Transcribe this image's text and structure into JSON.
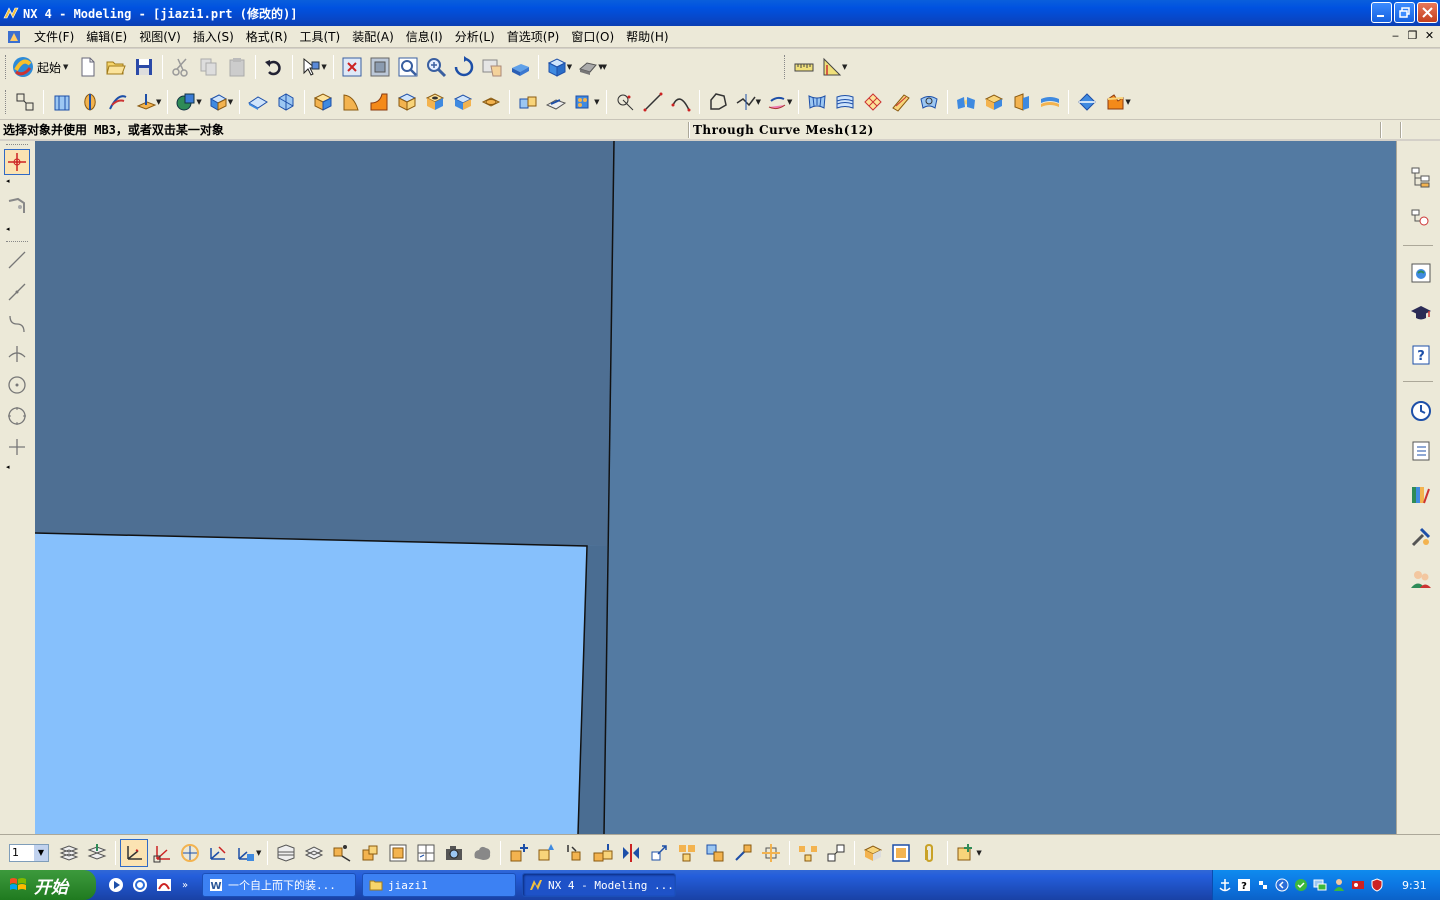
{
  "window": {
    "title": "NX 4 - Modeling - [jiazi1.prt (修改的)]"
  },
  "menubar": {
    "items": [
      "文件(F)",
      "编辑(E)",
      "视图(V)",
      "插入(S)",
      "格式(R)",
      "工具(T)",
      "装配(A)",
      "信息(I)",
      "分析(L)",
      "首选项(P)",
      "窗口(O)",
      "帮助(H)"
    ]
  },
  "toolbar": {
    "start_label": "起始"
  },
  "cue_line": {
    "prompt": "选择对象并使用 MB3，或者双击某一对象",
    "status": "Through Curve Mesh(12)"
  },
  "bottom_toolbar": {
    "layer_value": "1"
  },
  "taskbar": {
    "start_label": "开始",
    "tasks": [
      {
        "label": "一个自上而下的装...",
        "icon": "word-doc-icon"
      },
      {
        "label": "jiazi1",
        "icon": "folder-icon"
      },
      {
        "label": "NX 4 - Modeling ...",
        "icon": "nx-app-icon"
      }
    ],
    "clock": "9:31"
  },
  "colors": {
    "titlebar": "#0052e0",
    "viewport_bg": "#50779f",
    "face_dark": "#4e6f93",
    "face_light": "#86c0fc",
    "face_right": "#537aa2"
  }
}
